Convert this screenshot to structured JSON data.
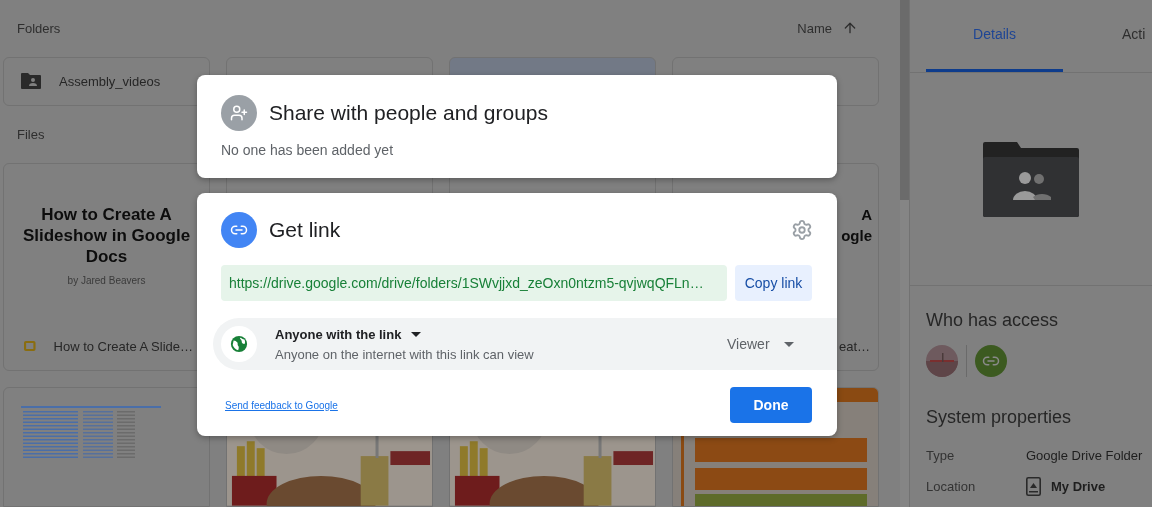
{
  "main": {
    "folders_heading": "Folders",
    "sort": {
      "label": "Name"
    },
    "folders": [
      {
        "name": "Assembly_videos",
        "selected": false
      },
      {
        "selected": false
      },
      {
        "selected": true
      },
      {
        "selected": false
      }
    ],
    "files_heading": "Files",
    "files": [
      {
        "kind": "slide",
        "thumb_lines": [
          "How to Create A",
          "Slideshow in Google",
          "Docs"
        ],
        "byline": "by Jared Beavers",
        "name": "How to Create A Slide…"
      },
      {
        "kind": "covered"
      },
      {
        "kind": "covered"
      },
      {
        "kind": "clipped",
        "thumb_lines": [
          "A",
          "ogle"
        ],
        "name": "eat…"
      },
      {
        "kind": "sheet"
      },
      {
        "kind": "picture"
      },
      {
        "kind": "picture"
      },
      {
        "kind": "picture"
      }
    ]
  },
  "dialog": {
    "share": {
      "title": "Share with people and groups",
      "subtitle": "No one has been added yet"
    },
    "get_link": {
      "title": "Get link",
      "url": "https://drive.google.com/drive/folders/1SWvjjxd_zeOxn0ntzm5-qvjwqQFLn…",
      "copy_button": "Copy link",
      "access": {
        "scope": "Anyone with the link",
        "description": "Anyone on the internet with this link can view",
        "role": "Viewer"
      },
      "feedback_link": "Send feedback to Google",
      "done_button": "Done"
    }
  },
  "details_panel": {
    "tabs": [
      {
        "label": "Details",
        "selected": true
      },
      {
        "label": "Acti",
        "selected": false
      }
    ],
    "who_has_access": {
      "heading": "Who has access",
      "people": [
        {
          "kind": "picture"
        },
        {
          "kind": "link"
        }
      ]
    },
    "system_properties": {
      "heading": "System properties",
      "rows": [
        {
          "kind": "text",
          "label": "Type",
          "value": "Google Drive Folder"
        },
        {
          "kind": "location",
          "label": "Location",
          "value": "My Drive"
        }
      ]
    }
  }
}
